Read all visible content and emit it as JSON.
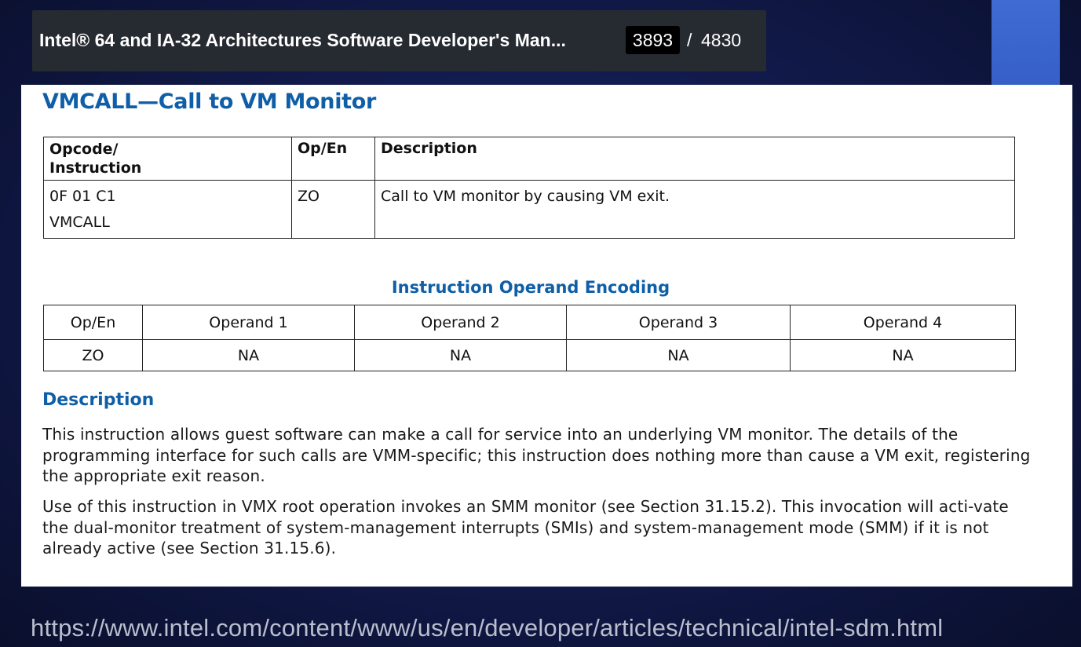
{
  "viewer": {
    "title": "Intel® 64 and IA-32 Architectures Software Developer's Man...",
    "current_page": "3893",
    "separator": "/",
    "total_pages": "4830"
  },
  "document": {
    "title": "VMCALL—Call to VM Monitor",
    "opcode_table": {
      "headers": [
        "Opcode/\nInstruction",
        "Op/En",
        "Description"
      ],
      "rows": [
        {
          "opcode": "0F 01 C1",
          "instruction": "VMCALL",
          "op_en": "ZO",
          "description": "Call to VM monitor by causing VM exit."
        }
      ]
    },
    "encoding_title": "Instruction Operand Encoding",
    "encoding_table": {
      "headers": [
        "Op/En",
        "Operand 1",
        "Operand 2",
        "Operand 3",
        "Operand 4"
      ],
      "row": [
        "ZO",
        "NA",
        "NA",
        "NA",
        "NA"
      ]
    },
    "description_heading": "Description",
    "paragraphs": [
      "This instruction allows guest software can make a call for service into an underlying VM monitor. The details of the programming interface for such calls are VMM-specific; this instruction does nothing more than cause a VM exit, registering the appropriate exit reason.",
      "Use of this instruction in VMX root operation invokes an SMM monitor (see Section 31.15.2). This invocation will acti-vate the dual-monitor treatment of system-management interrupts (SMIs) and system-management mode (SMM) if it is not already active (see Section 31.15.6)."
    ]
  },
  "source_url": "https://www.intel.com/content/www/us/en/developer/articles/technical/intel-sdm.html",
  "colors": {
    "heading_blue": "#0f5fa8",
    "viewer_bar": "#262a31",
    "accent_block": "#3f6bd3"
  }
}
